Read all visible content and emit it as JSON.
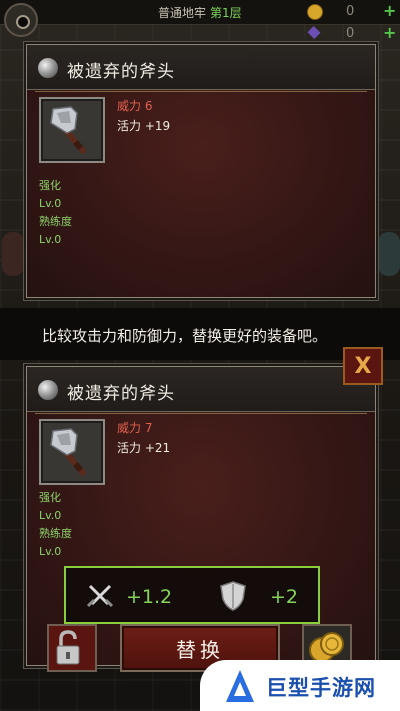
{
  "header": {
    "floor_label": "普通地牢",
    "floor_level": "第1层",
    "gold_value": "0",
    "gem_value": "0"
  },
  "items": [
    {
      "name": "被遗弃的斧头",
      "power": "威力 6",
      "vitality": "活力 +19",
      "enhance_label": "强化",
      "enhance_level": "Lv.0",
      "mastery_label": "熟练度",
      "mastery_level": "Lv.0"
    },
    {
      "name": "被遗弃的斧头",
      "power": "威力 7",
      "vitality": "活力 +21",
      "enhance_label": "强化",
      "enhance_level": "Lv.0",
      "mastery_label": "熟练度",
      "mastery_level": "Lv.0"
    }
  ],
  "tip": "比较攻击力和防御力，替换更好的装备吧。",
  "compare": {
    "attack_delta": "+1.2",
    "defense_delta": "+2"
  },
  "actions": {
    "replace_label": "替换",
    "close_glyph": "X"
  },
  "watermark": {
    "text": "巨型手游网"
  },
  "colors": {
    "accent_green": "#87d35a",
    "stat_red": "#e0604e",
    "button_red": "#5a1510"
  }
}
